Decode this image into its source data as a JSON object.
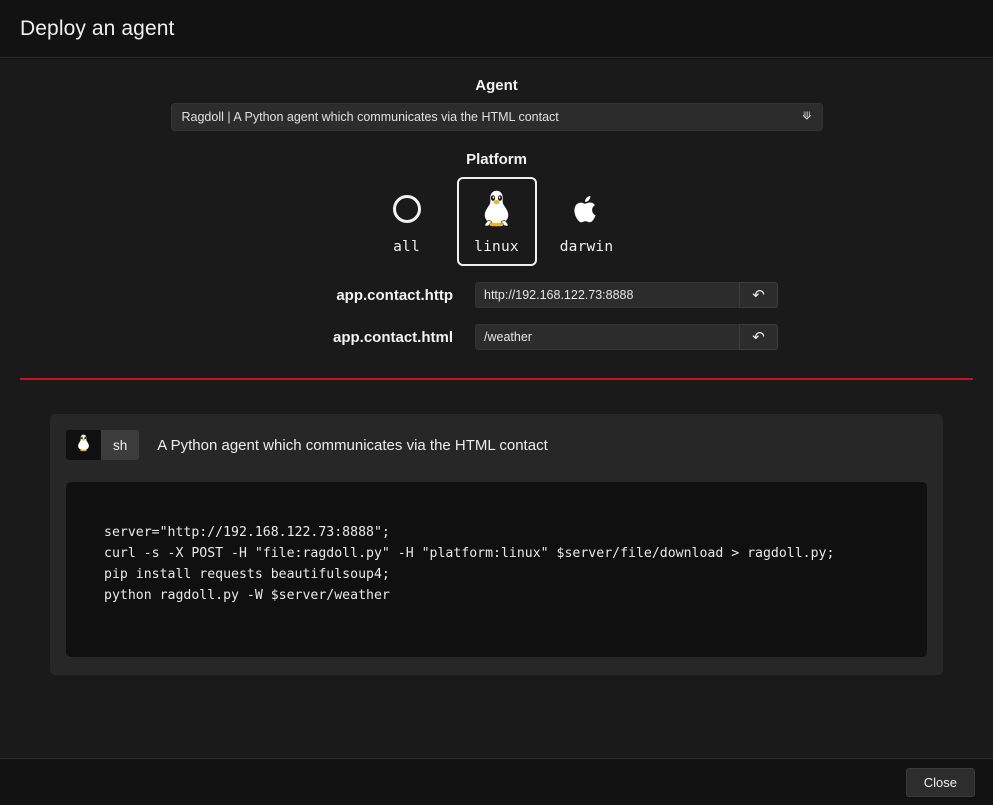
{
  "window": {
    "title": "Deploy an agent"
  },
  "agent": {
    "label": "Agent",
    "selected": "Ragdoll | A Python agent which communicates via the HTML contact",
    "chevron_icon": "chevron-down-icon"
  },
  "platform": {
    "label": "Platform",
    "selected": "linux",
    "options": [
      {
        "name": "all",
        "icon": "circle-icon"
      },
      {
        "name": "linux",
        "icon": "tux-icon"
      },
      {
        "name": "darwin",
        "icon": "apple-icon"
      }
    ]
  },
  "fields": [
    {
      "label": "app.contact.http",
      "value": "http://192.168.122.73:8888",
      "placeholder": "http://192.168.122.73:8888",
      "reset_icon": "undo-icon"
    },
    {
      "label": "app.contact.html",
      "value": "/weather",
      "placeholder": "/weather",
      "reset_icon": "undo-icon"
    }
  ],
  "snippet": {
    "platform_icon": "tux-icon",
    "language": "sh",
    "description": "A Python agent which communicates via the HTML contact",
    "code": "server=\"http://192.168.122.73:8888\";\ncurl -s -X POST -H \"file:ragdoll.py\" -H \"platform:linux\" $server/file/download > ragdoll.py;\npip install requests beautifulsoup4;\npython ragdoll.py -W $server/weather"
  },
  "footer": {
    "close_label": "Close"
  },
  "colors": {
    "accent_rule": "#cc1122",
    "page_background": "#1a1a1a",
    "chrome_background": "#121212",
    "card_background": "#272727",
    "code_background": "#101010"
  }
}
